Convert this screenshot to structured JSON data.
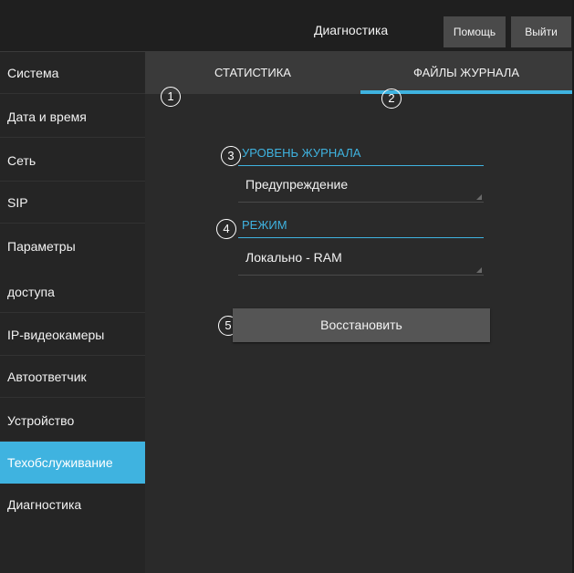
{
  "header": {
    "title": "Диагностика",
    "help_label": "Помощь",
    "exit_label": "Выйти"
  },
  "sidebar": {
    "items": [
      {
        "label": "Система"
      },
      {
        "label": "Дата и время"
      },
      {
        "label": "Сеть"
      },
      {
        "label": "SIP"
      },
      {
        "label": "Параметры"
      },
      {
        "label": "доступа"
      },
      {
        "label": "IP-видеокамеры"
      },
      {
        "label": "Автоответчик"
      },
      {
        "label": "Устройство"
      },
      {
        "label": "Техобслуживание",
        "active": true
      },
      {
        "label": "Диагностика"
      }
    ]
  },
  "tabs": [
    {
      "label": "СТАТИСТИКА"
    },
    {
      "label": "ФАЙЛЫ ЖУРНАЛА",
      "active": true
    }
  ],
  "callouts": [
    "1",
    "2",
    "3",
    "4",
    "5"
  ],
  "log_level": {
    "label": "УРОВЕНЬ ЖУРНАЛА",
    "value": "Предупреждение"
  },
  "mode": {
    "label": "РЕЖИМ",
    "value": "Локально - RAM"
  },
  "restore_label": "Восстановить",
  "colors": {
    "accent": "#3fb3e0",
    "background": "#2a2a2a",
    "sidebar": "#252525",
    "topbar": "#1f1f1f",
    "button": "#4a4a4a"
  }
}
